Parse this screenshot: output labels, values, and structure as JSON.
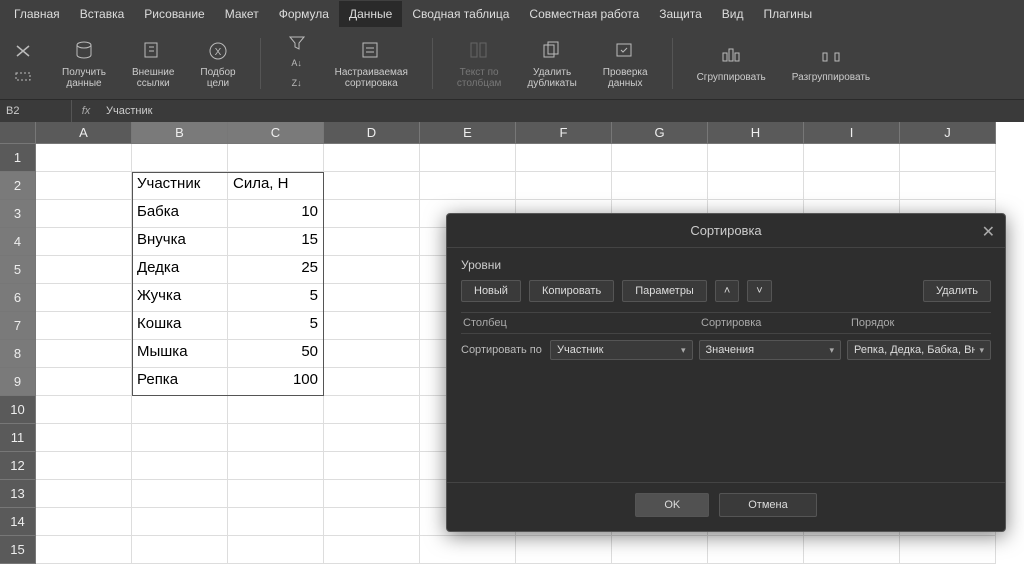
{
  "menu": [
    "Главная",
    "Вставка",
    "Рисование",
    "Макет",
    "Формула",
    "Данные",
    "Сводная таблица",
    "Совместная работа",
    "Защита",
    "Вид",
    "Плагины"
  ],
  "menu_active": 5,
  "ribbon": {
    "get_data": "Получить\nданные",
    "ext_links": "Внешние\nссылки",
    "goal_seek": "Подбор\nцели",
    "custom_sort": "Настраиваемая\nсортировка",
    "text_cols": "Текст по\nстолбцам",
    "rm_dup": "Удалить\nдубликаты",
    "data_val": "Проверка\nданных",
    "group": "Сгруппировать",
    "ungroup": "Разгруппировать"
  },
  "cellref": "B2",
  "cellval": "Участник",
  "cols": [
    "A",
    "B",
    "C",
    "D",
    "E",
    "F",
    "G",
    "H",
    "I",
    "J"
  ],
  "sel_cols": [
    1,
    2
  ],
  "rows": 15,
  "sel_rows": [
    2,
    3,
    4,
    5,
    6,
    7,
    8,
    9
  ],
  "table": {
    "header": [
      "Участник",
      "Сила, Н"
    ],
    "rows": [
      [
        "Бабка",
        "10"
      ],
      [
        "Внучка",
        "15"
      ],
      [
        "Дедка",
        "25"
      ],
      [
        "Жучка",
        "5"
      ],
      [
        "Кошка",
        "5"
      ],
      [
        "Мышка",
        "50"
      ],
      [
        "Репка",
        "100"
      ]
    ]
  },
  "dialog": {
    "title": "Сортировка",
    "levels_label": "Уровни",
    "new_btn": "Новый",
    "copy_btn": "Копировать",
    "params_btn": "Параметры",
    "delete_btn": "Удалить",
    "col_head": "Столбец",
    "sort_head": "Сортировка",
    "order_head": "Порядок",
    "sort_by": "Сортировать по",
    "col_val": "Участник",
    "sort_val": "Значения",
    "order_val": "Репка, Дедка, Бабка, Вн",
    "ok": "OK",
    "cancel": "Отмена"
  }
}
